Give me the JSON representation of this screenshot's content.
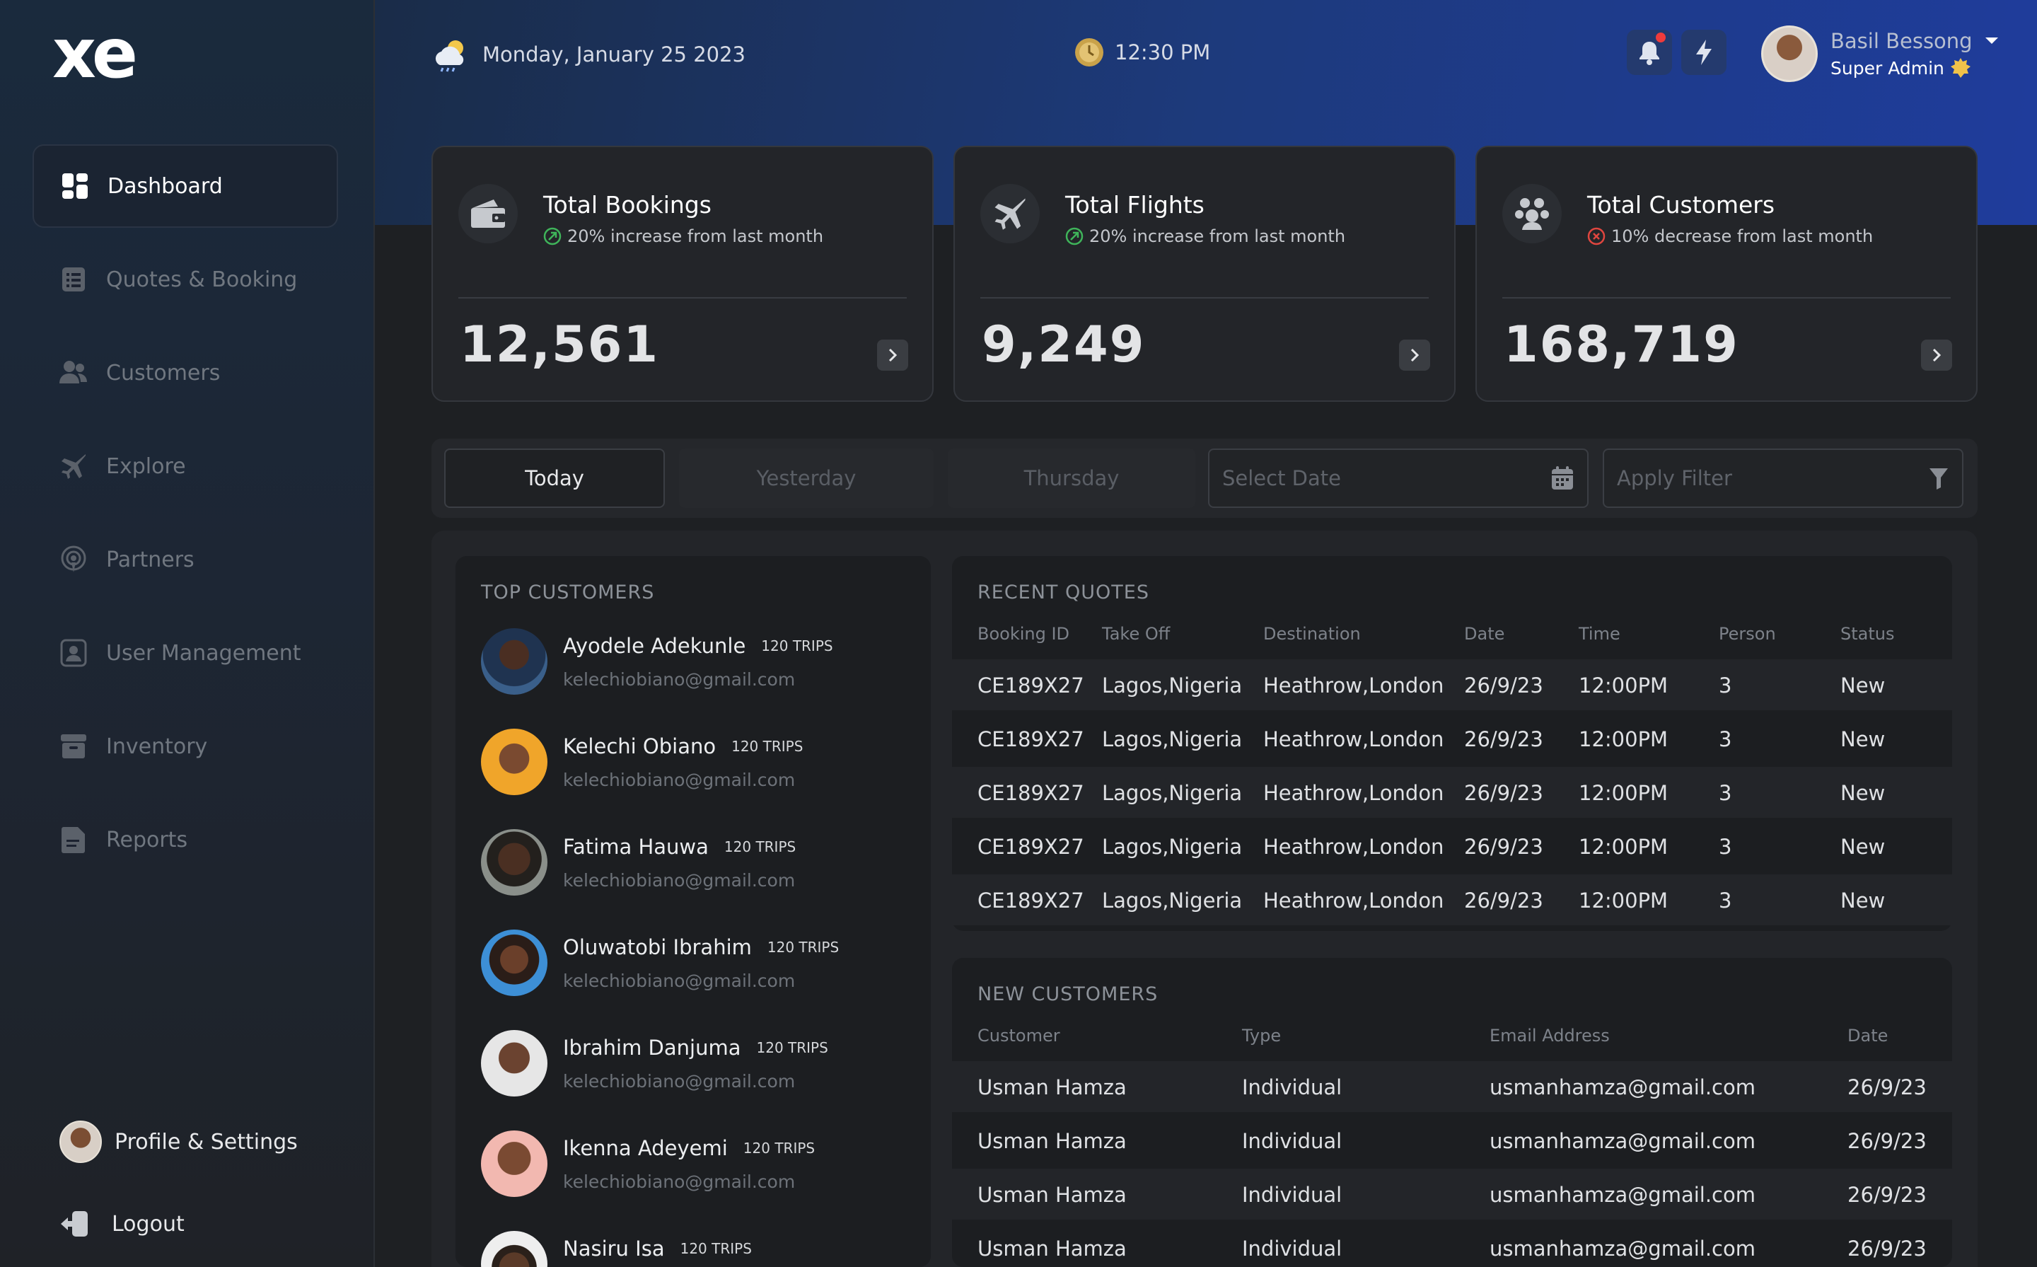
{
  "brand": {
    "logo_text": "xe"
  },
  "sidebar": {
    "items": [
      {
        "label": "Dashboard",
        "icon": "dashboard-icon",
        "active": true
      },
      {
        "label": "Quotes & Booking",
        "icon": "list-icon",
        "active": false
      },
      {
        "label": "Customers",
        "icon": "users-icon",
        "active": false
      },
      {
        "label": "Explore",
        "icon": "plane-icon",
        "active": false
      },
      {
        "label": "Partners",
        "icon": "broadcast-icon",
        "active": false
      },
      {
        "label": "User Management",
        "icon": "user-card-icon",
        "active": false
      },
      {
        "label": "Inventory",
        "icon": "archive-icon",
        "active": false
      },
      {
        "label": "Reports",
        "icon": "report-icon",
        "active": false
      }
    ],
    "profile_label": "Profile & Settings",
    "logout_label": "Logout"
  },
  "header": {
    "date": "Monday, January 25 2023",
    "time": "12:30 PM",
    "user_name": "Basil Bessong",
    "user_role": "Super Admin",
    "accent": "#1f3c9c"
  },
  "stats": [
    {
      "title": "Total Bookings",
      "change": "20% increase from last month",
      "trend": "up",
      "value": "12,561",
      "icon": "wallet-icon"
    },
    {
      "title": "Total Flights",
      "change": "20% increase from last month",
      "trend": "up",
      "value": "9,249",
      "icon": "plane-icon"
    },
    {
      "title": "Total Customers",
      "change": "10% decrease from last month",
      "trend": "down",
      "value": "168,719",
      "icon": "group-icon"
    }
  ],
  "filters": {
    "tabs": [
      "Today",
      "Yesterday",
      "Thursday"
    ],
    "date_placeholder": "Select Date",
    "filter_placeholder": "Apply Filter"
  },
  "top_customers": {
    "title": "TOP CUSTOMERS",
    "items": [
      {
        "name": "Ayodele Adekunle",
        "trips": "120 TRIPS",
        "email": "kelechiobiano@gmail.com",
        "avatar_bg": "#3a5f8a"
      },
      {
        "name": "Kelechi Obiano",
        "trips": "120 TRIPS",
        "email": "kelechiobiano@gmail.com",
        "avatar_bg": "#f0a52a"
      },
      {
        "name": "Fatima Hauwa",
        "trips": "120 TRIPS",
        "email": "kelechiobiano@gmail.com",
        "avatar_bg": "#8a8f8a"
      },
      {
        "name": "Oluwatobi Ibrahim",
        "trips": "120 TRIPS",
        "email": "kelechiobiano@gmail.com",
        "avatar_bg": "#3d8fd6"
      },
      {
        "name": "Ibrahim Danjuma",
        "trips": "120 TRIPS",
        "email": "kelechiobiano@gmail.com",
        "avatar_bg": "#e6e6e6"
      },
      {
        "name": "Ikenna Adeyemi",
        "trips": "120 TRIPS",
        "email": "kelechiobiano@gmail.com",
        "avatar_bg": "#f2b8b0"
      },
      {
        "name": "Nasiru Isa",
        "trips": "120 TRIPS",
        "email": "",
        "avatar_bg": "#eeeeee"
      }
    ]
  },
  "recent_quotes": {
    "title": "RECENT QUOTES",
    "columns": [
      "Booking ID",
      "Take Off",
      "Destination",
      "Date",
      "Time",
      "Person",
      "Status"
    ],
    "rows": [
      [
        "CE189X27",
        "Lagos,Nigeria",
        "Heathrow,London",
        "26/9/23",
        "12:00PM",
        "3",
        "New"
      ],
      [
        "CE189X27",
        "Lagos,Nigeria",
        "Heathrow,London",
        "26/9/23",
        "12:00PM",
        "3",
        "New"
      ],
      [
        "CE189X27",
        "Lagos,Nigeria",
        "Heathrow,London",
        "26/9/23",
        "12:00PM",
        "3",
        "New"
      ],
      [
        "CE189X27",
        "Lagos,Nigeria",
        "Heathrow,London",
        "26/9/23",
        "12:00PM",
        "3",
        "New"
      ],
      [
        "CE189X27",
        "Lagos,Nigeria",
        "Heathrow,London",
        "26/9/23",
        "12:00PM",
        "3",
        "New"
      ]
    ]
  },
  "new_customers": {
    "title": "NEW CUSTOMERS",
    "columns": [
      "Customer",
      "Type",
      "Email Address",
      "Date"
    ],
    "rows": [
      [
        "Usman Hamza",
        "Individual",
        "usmanhamza@gmail.com",
        "26/9/23"
      ],
      [
        "Usman Hamza",
        "Individual",
        "usmanhamza@gmail.com",
        "26/9/23"
      ],
      [
        "Usman Hamza",
        "Individual",
        "usmanhamza@gmail.com",
        "26/9/23"
      ],
      [
        "Usman Hamza",
        "Individual",
        "usmanhamza@gmail.com",
        "26/9/23"
      ]
    ]
  }
}
